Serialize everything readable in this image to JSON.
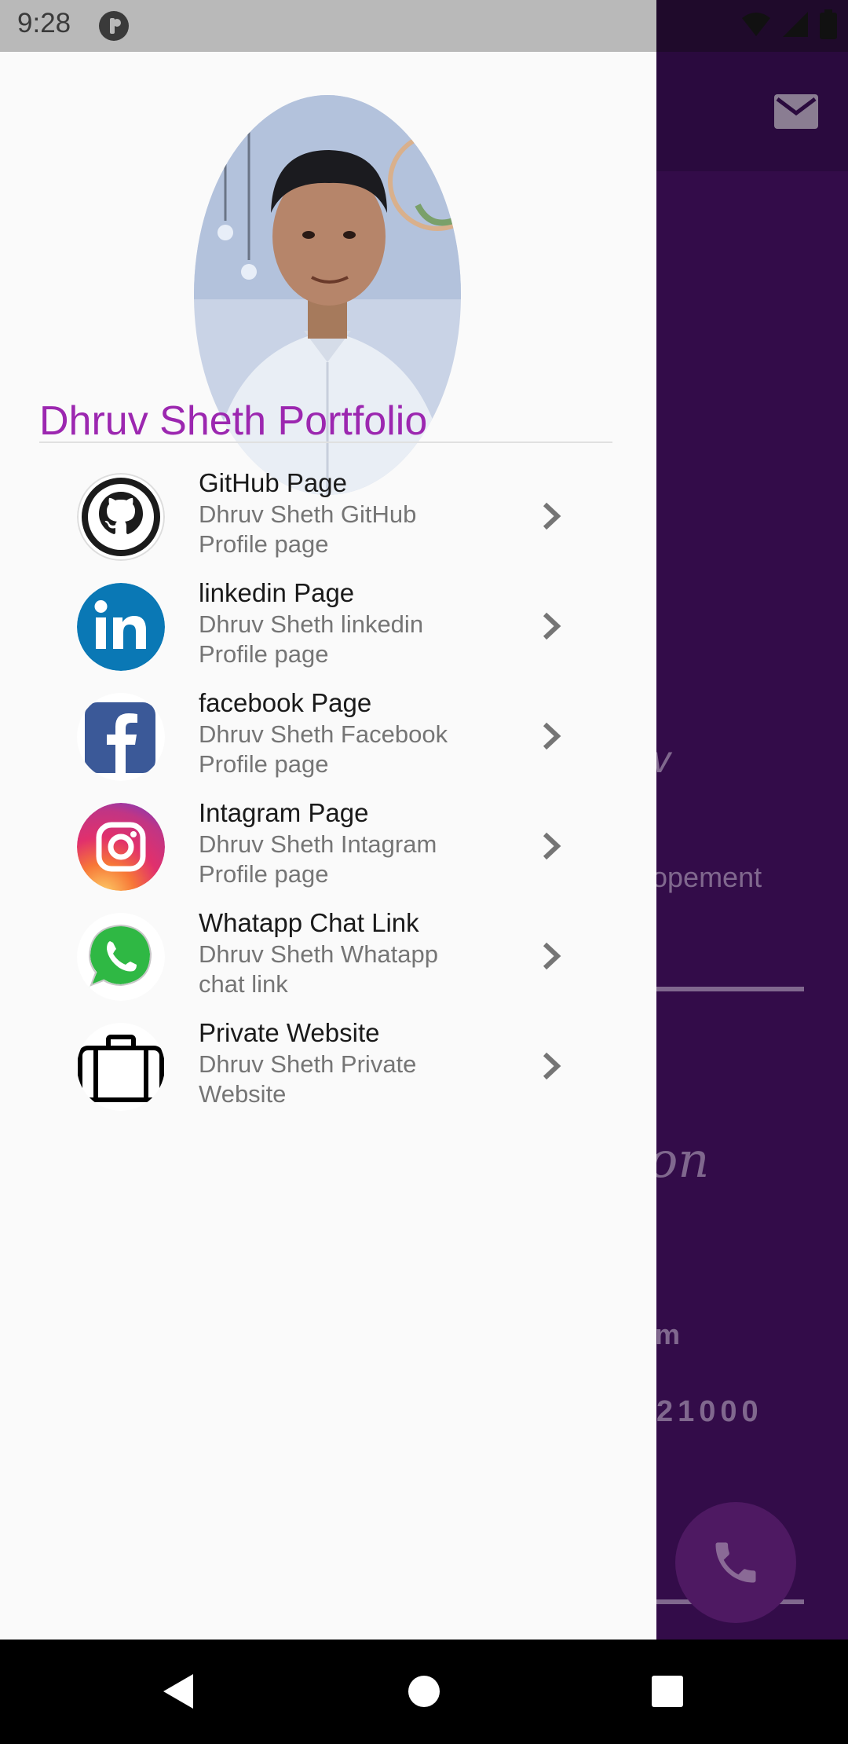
{
  "status_bar": {
    "time": "9:28"
  },
  "background_screen": {
    "text_fragments": [
      "v",
      "opement",
      "on",
      "m",
      "21000"
    ]
  },
  "drawer": {
    "title": "Dhruv Sheth Portfolio",
    "items": [
      {
        "title": "GitHub Page",
        "subtitle": "Dhruv Sheth GitHub Profile page",
        "icon": "github-icon"
      },
      {
        "title": "linkedin Page",
        "subtitle": "Dhruv Sheth linkedin Profile page",
        "icon": "linkedin-icon"
      },
      {
        "title": "facebook Page",
        "subtitle": "Dhruv Sheth Facebook Profile page",
        "icon": "facebook-icon"
      },
      {
        "title": "Intagram Page",
        "subtitle": "Dhruv Sheth Intagram Profile page",
        "icon": "instagram-icon"
      },
      {
        "title": "Whatapp Chat Link",
        "subtitle": "Dhruv Sheth Whatapp chat link",
        "icon": "whatsapp-icon"
      },
      {
        "title": "Private Website",
        "subtitle": "Dhruv Sheth Private Website",
        "icon": "briefcase-icon"
      }
    ]
  },
  "colors": {
    "accent": "#9c27b0",
    "background_screen": "#330c49",
    "drawer_background": "#fafafa"
  }
}
